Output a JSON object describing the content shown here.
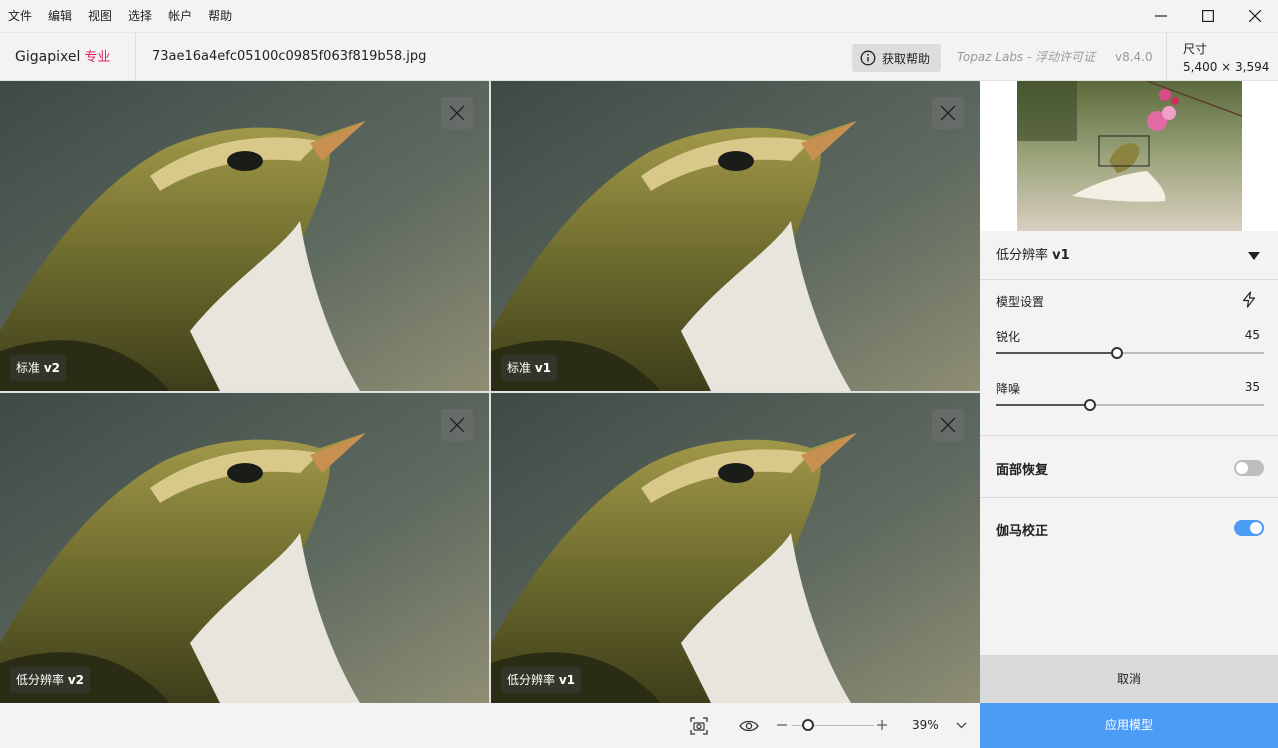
{
  "menu": [
    "文件",
    "编辑",
    "视图",
    "选择",
    "帐户",
    "帮助"
  ],
  "header": {
    "brand": "Gigapixel",
    "brand_tag": "专业",
    "filename": "73ae16a4efc05100c0985f063f819b58.jpg",
    "help_label": "获取帮助",
    "license": "Topaz Labs - 浮动许可证",
    "version": "v8.4.0",
    "size_label": "尺寸",
    "size_value": "5,400 × 3,594"
  },
  "panels": [
    {
      "name": "标准",
      "version": "v2",
      "selected": false
    },
    {
      "name": "标准",
      "version": "v1",
      "selected": false
    },
    {
      "name": "低分辨率",
      "version": "v2",
      "selected": false
    },
    {
      "name": "低分辨率",
      "version": "v1",
      "selected": true
    }
  ],
  "toolbar": {
    "zoom": "39%",
    "zoom_fraction": 0.2
  },
  "side": {
    "model_name": "低分辨率",
    "model_version": "v1",
    "settings_title": "模型设置",
    "sharpen_label": "锐化",
    "sharpen_value": "45",
    "sharpen_level": 0.45,
    "denoise_label": "降噪",
    "denoise_value": "35",
    "denoise_level": 0.35,
    "face_label": "面部恢复",
    "face_on": false,
    "gamma_label": "伽马校正",
    "gamma_on": true,
    "cancel_label": "取消",
    "apply_label": "应用模型"
  },
  "colors": {
    "accent": "#4a9cf5",
    "selection": "#4a90e2",
    "brand_tag": "#e0245e",
    "toggle_off": "#bdbdbd"
  }
}
